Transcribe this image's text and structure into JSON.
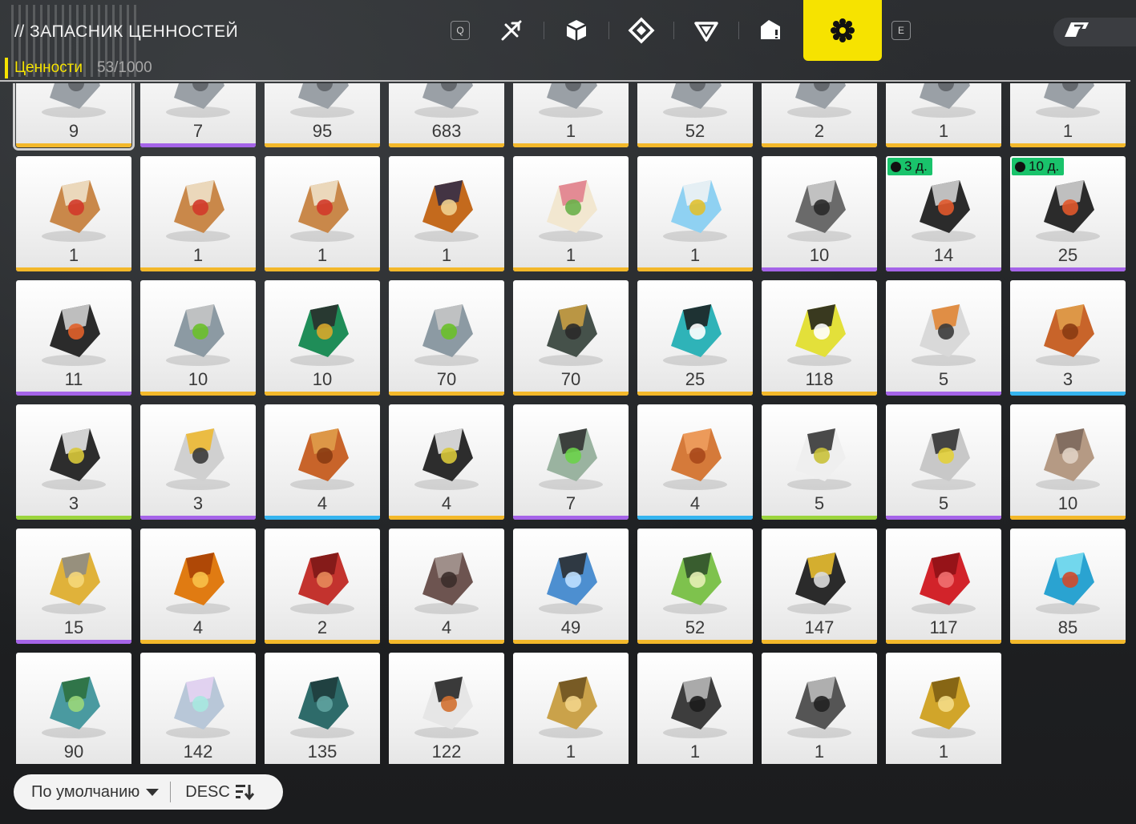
{
  "header": {
    "title": "// ЗАПАСНИК ЦЕННОСТЕЙ",
    "section_label": "Ценности",
    "section_count": "53/1000",
    "left_key": "Q",
    "right_key": "E",
    "tabs": [
      {
        "icon": "tool-slash-icon",
        "active": false
      },
      {
        "icon": "cube-icon",
        "active": false
      },
      {
        "icon": "diamond-rune-icon",
        "active": false
      },
      {
        "icon": "triangle-gem-icon",
        "active": false
      },
      {
        "icon": "box-alert-icon",
        "active": false
      },
      {
        "icon": "gear-flower-icon",
        "active": true
      }
    ],
    "top_right_icon": "badge-icon"
  },
  "colors": {
    "accent": "#f6e300",
    "rarity_gold": "#f3b82a",
    "rarity_purple": "#a564e8",
    "rarity_blue": "#35b4ef",
    "rarity_green": "#9bd43d",
    "timer_green": "#19c36b"
  },
  "items": [
    {
      "qty": "9",
      "rarity": "gold",
      "icon": "blueprint-icon",
      "selected": true
    },
    {
      "qty": "7",
      "rarity": "purple",
      "icon": "document-icon"
    },
    {
      "qty": "95",
      "rarity": "gold",
      "icon": "red-chip-icon"
    },
    {
      "qty": "683",
      "rarity": "gold",
      "icon": "blue-module-icon"
    },
    {
      "qty": "1",
      "rarity": "gold",
      "icon": "card-pack-icon"
    },
    {
      "qty": "52",
      "rarity": "gold",
      "icon": "device-icon"
    },
    {
      "qty": "2",
      "rarity": "gold",
      "icon": "cable-icon"
    },
    {
      "qty": "1",
      "rarity": "gold",
      "icon": "crate-icon"
    },
    {
      "qty": "1",
      "rarity": "gold",
      "icon": "machine-icon"
    },
    {
      "qty": "1",
      "rarity": "gold",
      "icon": "steamer-bun-icon"
    },
    {
      "qty": "1",
      "rarity": "gold",
      "icon": "steamer-bun-icon"
    },
    {
      "qty": "1",
      "rarity": "gold",
      "icon": "steamer-bun-icon"
    },
    {
      "qty": "1",
      "rarity": "gold",
      "icon": "honey-jar-icon"
    },
    {
      "qty": "1",
      "rarity": "gold",
      "icon": "crepe-cone-icon"
    },
    {
      "qty": "1",
      "rarity": "gold",
      "icon": "parfait-glass-icon"
    },
    {
      "qty": "10",
      "rarity": "purple",
      "icon": "engine-block-icon"
    },
    {
      "qty": "14",
      "rarity": "purple",
      "icon": "beacon-icon",
      "timer": "3 д."
    },
    {
      "qty": "25",
      "rarity": "purple",
      "icon": "beacon-icon",
      "timer": "10 д."
    },
    {
      "qty": "11",
      "rarity": "purple",
      "icon": "drill-part-icon"
    },
    {
      "qty": "10",
      "rarity": "gold",
      "icon": "drone-frame-icon"
    },
    {
      "qty": "10",
      "rarity": "gold",
      "icon": "platform-green-icon"
    },
    {
      "qty": "70",
      "rarity": "gold",
      "icon": "drone-frame-icon"
    },
    {
      "qty": "70",
      "rarity": "gold",
      "icon": "platform-gold-icon"
    },
    {
      "qty": "25",
      "rarity": "gold",
      "icon": "exchange-ticket-icon"
    },
    {
      "qty": "118",
      "rarity": "gold",
      "icon": "exchange-ticket-yellow-icon"
    },
    {
      "qty": "5",
      "rarity": "purple",
      "icon": "canister-icon"
    },
    {
      "qty": "3",
      "rarity": "blue",
      "icon": "ore-shard-icon"
    },
    {
      "qty": "3",
      "rarity": "green",
      "icon": "photo-folder-icon"
    },
    {
      "qty": "3",
      "rarity": "purple",
      "icon": "canister-yellow-icon"
    },
    {
      "qty": "4",
      "rarity": "blue",
      "icon": "ore-shard-icon"
    },
    {
      "qty": "4",
      "rarity": "gold",
      "icon": "photo-folder-icon"
    },
    {
      "qty": "7",
      "rarity": "purple",
      "icon": "capsule-green-icon"
    },
    {
      "qty": "4",
      "rarity": "blue",
      "icon": "copper-part-icon"
    },
    {
      "qty": "5",
      "rarity": "green",
      "icon": "paper-stack-icon"
    },
    {
      "qty": "5",
      "rarity": "purple",
      "icon": "capsule-yellow-icon"
    },
    {
      "qty": "10",
      "rarity": "gold",
      "icon": "scrap-metal-icon"
    },
    {
      "qty": "15",
      "rarity": "purple",
      "icon": "crystal-spike-icon"
    },
    {
      "qty": "4",
      "rarity": "gold",
      "icon": "amber-gem-icon"
    },
    {
      "qty": "2",
      "rarity": "gold",
      "icon": "red-bar-icon"
    },
    {
      "qty": "4",
      "rarity": "gold",
      "icon": "rusty-crate-icon"
    },
    {
      "qty": "49",
      "rarity": "gold",
      "icon": "dumbbell-icon"
    },
    {
      "qty": "52",
      "rarity": "gold",
      "icon": "green-circuit-icon"
    },
    {
      "qty": "147",
      "rarity": "gold",
      "icon": "magazine-icon"
    },
    {
      "qty": "117",
      "rarity": "gold",
      "icon": "red-cloth-icon"
    },
    {
      "qty": "85",
      "rarity": "gold",
      "icon": "blue-crystal-icon"
    },
    {
      "qty": "90",
      "rarity": "gold",
      "icon": "perfume-bottle-icon"
    },
    {
      "qty": "142",
      "rarity": "gold",
      "icon": "holo-card-icon"
    },
    {
      "qty": "135",
      "rarity": "gold",
      "icon": "teal-puzzle-icon"
    },
    {
      "qty": "122",
      "rarity": "gold",
      "icon": "camera-icon"
    },
    {
      "qty": "1",
      "rarity": "gold",
      "icon": "golden-plant-icon"
    },
    {
      "qty": "1",
      "rarity": "gold",
      "icon": "tank-vehicle-icon"
    },
    {
      "qty": "1",
      "rarity": "gold",
      "icon": "motorbike-icon"
    },
    {
      "qty": "1",
      "rarity": "gold",
      "icon": "golden-rabbit-icon"
    }
  ],
  "sort": {
    "option_label": "По умолчанию",
    "direction_label": "DESC"
  }
}
